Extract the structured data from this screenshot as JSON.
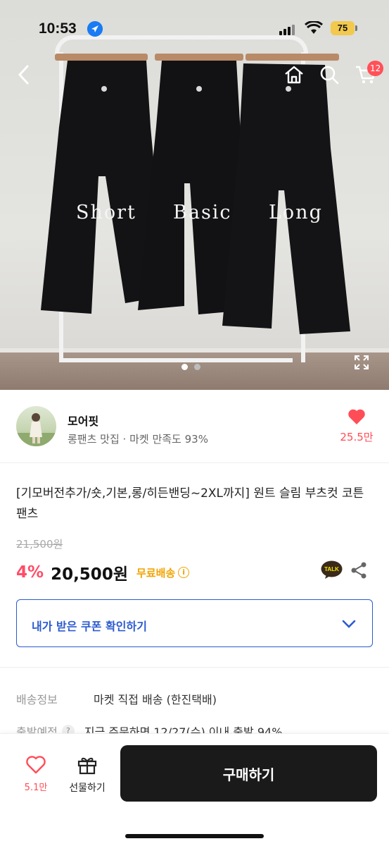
{
  "status_bar": {
    "time": "10:53",
    "battery": "75"
  },
  "nav": {
    "cart_count": "12"
  },
  "hero": {
    "labels": [
      "Short",
      "Basic",
      "Long"
    ],
    "page_indicator": {
      "current": 1,
      "total": 2
    }
  },
  "seller": {
    "name": "모어핏",
    "description": "롱팬츠 맛집 · 마켓 만족도 93%",
    "likes": "25.5만"
  },
  "product": {
    "title": "[기모버전추가/숏,기본,롱/히든밴딩~2XL까지] 원트 슬림 부츠컷 코튼 팬츠",
    "original_price": "21,500원",
    "discount": "4%",
    "price": "20,500원",
    "shipping_badge": "무료배송"
  },
  "coupon": {
    "label": "내가 받은 쿠폰 확인하기"
  },
  "shipping": {
    "label": "배송정보",
    "value": "마켓 직접 배송 (한진택배)",
    "eta_label": "출발예정",
    "eta_value": "지금 주문하면 12/27(수) 이내 출발 94%"
  },
  "bottom_bar": {
    "likes": "5.1만",
    "gift_label": "선물하기",
    "buy_label": "구매하기"
  },
  "colors": {
    "accent_blue": "#2c5bcf",
    "like_red": "#ff4d57",
    "discount_pink": "#ff4d67",
    "free_ship": "#f2a300",
    "buy_button": "#1a1a1a"
  }
}
